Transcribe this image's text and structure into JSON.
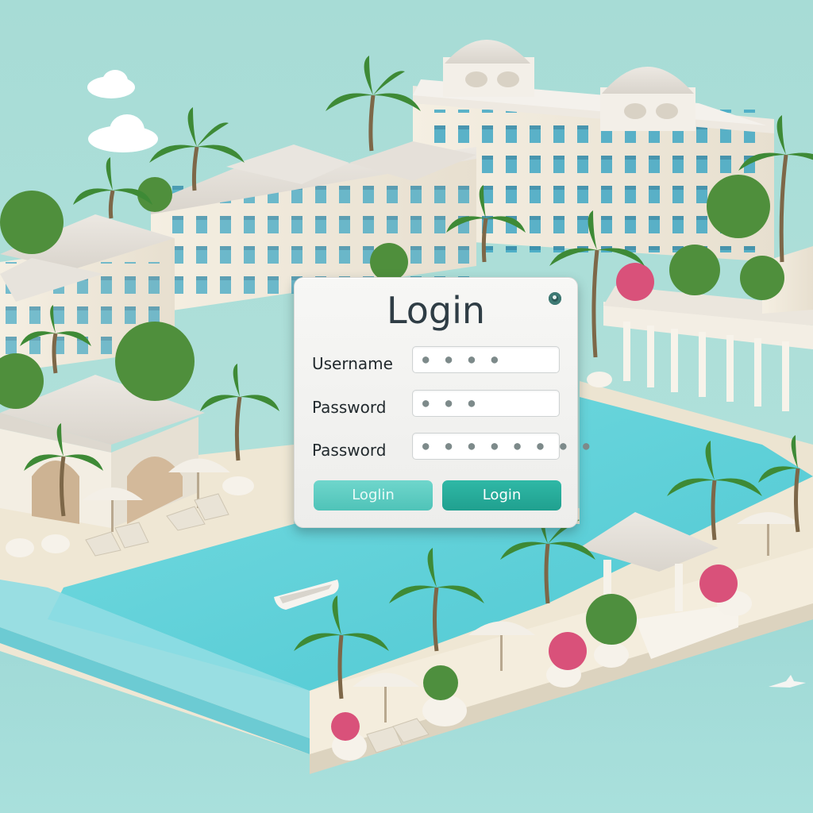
{
  "login": {
    "title": "Login",
    "fields": [
      {
        "label": "Username",
        "mask": "● ● ● ●"
      },
      {
        "label": "Password",
        "mask": "● ● ●"
      },
      {
        "label": "Password",
        "mask": "● ● ● ● ● ● ● ●"
      }
    ],
    "buttons": {
      "secondary_label": "Loglin",
      "primary_label": "Login"
    }
  },
  "colors": {
    "sky": "#a9dcd6",
    "pool_water": "#5fd0d8",
    "deck": "#f1ead8",
    "building": "#f3ede0",
    "palm": "#3f8a3a",
    "accent_button": "#20a08f",
    "light_button": "#4fc3b8"
  }
}
